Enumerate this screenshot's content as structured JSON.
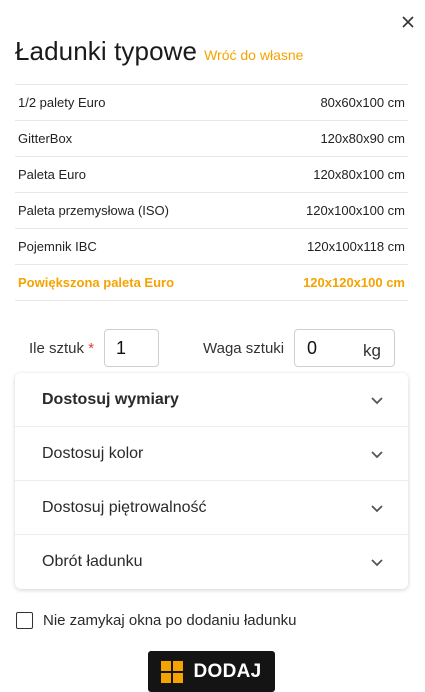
{
  "header": {
    "title": "Ładunki typowe",
    "back_link": "Wróć do własne"
  },
  "loads": [
    {
      "name": "1/2 palety Euro",
      "dims": "80x60x100 cm",
      "active": false
    },
    {
      "name": "GitterBox",
      "dims": "120x80x90 cm",
      "active": false
    },
    {
      "name": "Paleta Euro",
      "dims": "120x80x100 cm",
      "active": false
    },
    {
      "name": "Paleta przemysłowa (ISO)",
      "dims": "120x100x100 cm",
      "active": false
    },
    {
      "name": "Pojemnik IBC",
      "dims": "120x100x118 cm",
      "active": false
    },
    {
      "name": "Powiększona paleta Euro",
      "dims": "120x120x100 cm",
      "active": true
    }
  ],
  "quantity": {
    "label": "Ile sztuk",
    "required_mark": "*",
    "value": "1"
  },
  "weight": {
    "label": "Waga sztuki",
    "value": "0",
    "unit": "kg"
  },
  "accordion": [
    {
      "label": "Dostosuj wymiary"
    },
    {
      "label": "Dostosuj kolor"
    },
    {
      "label": "Dostosuj piętrowalność"
    },
    {
      "label": "Obrót ładunku"
    }
  ],
  "keep_open": {
    "label": "Nie zamykaj okna po dodaniu ładunku",
    "checked": false
  },
  "add_button": {
    "label": "DODAJ",
    "icon": "grid-icon"
  },
  "colors": {
    "accent": "#f5a300",
    "button_bg": "#141414",
    "required": "#e53935"
  }
}
